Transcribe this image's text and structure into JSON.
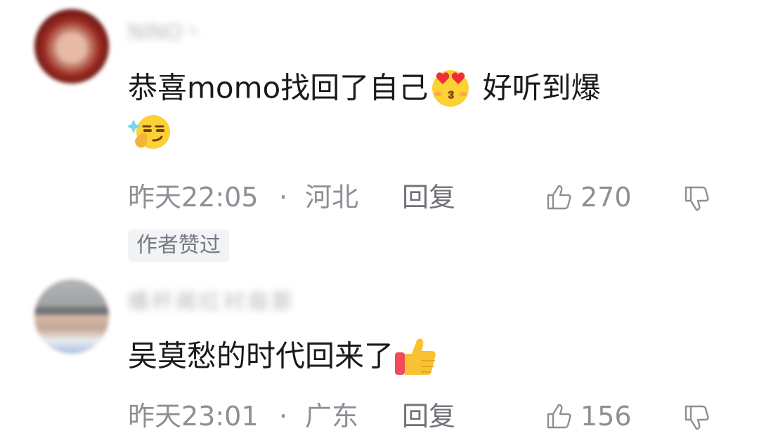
{
  "comments": [
    {
      "username": "NINO丶",
      "text": "恭喜momo找回了自己",
      "text_after": " 好听到爆",
      "emojis": [
        "heart-eyes-kiss-emoji",
        "smirk-emoji"
      ],
      "time": "昨天22:05",
      "separator": "·",
      "region": "河北",
      "reply": "回复",
      "likes": "270",
      "badge": "作者赞过"
    },
    {
      "username": "橘杆阁红衬扇那",
      "text": "吴莫愁的时代回来了",
      "emojis": [
        "thumbs-up-emoji"
      ],
      "time": "昨天23:01",
      "separator": "·",
      "region": "广东",
      "reply": "回复",
      "likes": "156"
    }
  ],
  "colors": {
    "background": "#ffffff",
    "text": "#1a1a1a",
    "meta": "#8c8f94",
    "badge_bg": "#f2f3f5"
  }
}
